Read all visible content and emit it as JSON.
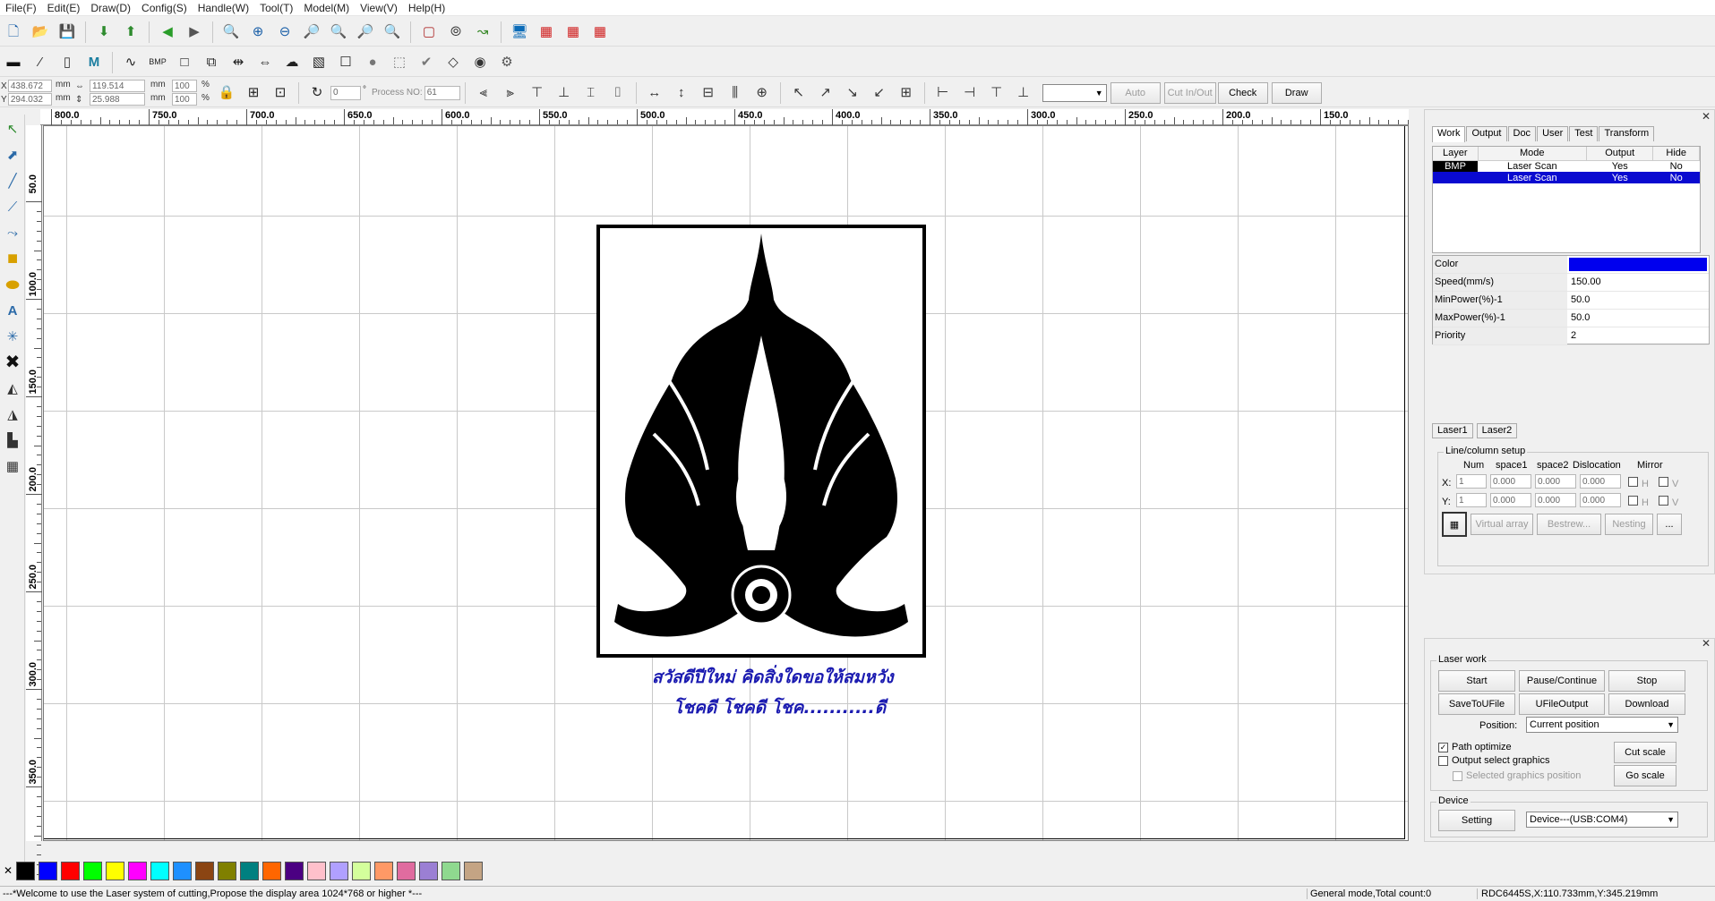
{
  "menu": [
    "File(F)",
    "Edit(E)",
    "Draw(D)",
    "Config(S)",
    "Handle(W)",
    "Tool(T)",
    "Model(M)",
    "View(V)",
    "Help(H)"
  ],
  "coords": {
    "x_label": "X",
    "x_value": "438.672",
    "x_unit": "mm",
    "y_label": "Y",
    "y_value": "294.032",
    "y_unit": "mm",
    "w_value": "119.514",
    "w_unit": "mm",
    "h_value": "25.988",
    "h_unit": "mm",
    "w_pct": "100",
    "h_pct": "100",
    "pct_unit": "%",
    "angle_value": "0",
    "angle_unit": "°",
    "process_label": "Process NO:",
    "process_value": "61"
  },
  "toolbar3": {
    "auto": "Auto",
    "cut_in_out": "Cut In/Out",
    "check": "Check",
    "draw": "Draw"
  },
  "toolbar2": {
    "bmp": "BMP",
    "m": "M"
  },
  "ruler_h": [
    "800.0",
    "750.0",
    "700.0",
    "650.0",
    "600.0",
    "550.0",
    "500.0",
    "450.0",
    "400.0",
    "350.0",
    "300.0",
    "250.0",
    "200.0",
    "150.0"
  ],
  "ruler_v": [
    "50.0",
    "100.0",
    "150.0",
    "200.0",
    "250.0",
    "300.0",
    "350.0"
  ],
  "canvas_text": {
    "line1": "สวัสดีปีใหม่ คิดสิ่งใดขอให้สมหวัง",
    "line2": "โชคดี โชคดี โชค...........ดี"
  },
  "panel": {
    "tabs": [
      "Work",
      "Output",
      "Doc",
      "User",
      "Test",
      "Transform"
    ],
    "active_tab": "Work",
    "layer_headers": [
      "Layer",
      "Mode",
      "Output",
      "Hide"
    ],
    "layers": [
      {
        "layer": "BMP",
        "mode": "Laser Scan",
        "output": "Yes",
        "hide": "No"
      },
      {
        "layer": "",
        "mode": "Laser Scan",
        "output": "Yes",
        "hide": "No"
      }
    ],
    "props": [
      {
        "key": "Color",
        "value": ""
      },
      {
        "key": "Speed(mm/s)",
        "value": "150.00"
      },
      {
        "key": "MinPower(%)-1",
        "value": "50.0"
      },
      {
        "key": "MaxPower(%)-1",
        "value": "50.0"
      },
      {
        "key": "Priority",
        "value": "2"
      }
    ],
    "color_swatch": "#0000ee",
    "laser_tabs": [
      "Laser1",
      "Laser2"
    ],
    "linecol": {
      "title": "Line/column setup",
      "headers": [
        "Num",
        "space1",
        "space2",
        "Dislocation",
        "Mirror"
      ],
      "x_label": "X:",
      "y_label": "Y:",
      "x": {
        "num": "1",
        "space1": "0.000",
        "space2": "0.000",
        "disloc": "0.000"
      },
      "y": {
        "num": "1",
        "space1": "0.000",
        "space2": "0.000",
        "disloc": "0.000"
      },
      "mirror_h": "H",
      "mirror_v": "V",
      "virtual_array": "Virtual array",
      "bestrew": "Bestrew...",
      "nesting": "Nesting",
      "more": "..."
    }
  },
  "laserwork": {
    "title": "Laser work",
    "start": "Start",
    "pause": "Pause/Continue",
    "stop": "Stop",
    "save_ufile": "SaveToUFile",
    "ufile_output": "UFileOutput",
    "download": "Download",
    "position_label": "Position:",
    "position_value": "Current position",
    "path_optimize": "Path optimize",
    "path_optimize_checked": true,
    "output_select": "Output select graphics",
    "selected_pos": "Selected graphics position",
    "cut_scale": "Cut scale",
    "go_scale": "Go scale",
    "device_title": "Device",
    "setting": "Setting",
    "device_value": "Device---(USB:COM4)"
  },
  "palette": [
    "#000000",
    "#0000ff",
    "#ff0000",
    "#00ff00",
    "#ffff00",
    "#ff00ff",
    "#00ffff",
    "#1e90ff",
    "#8b4513",
    "#808000",
    "#008080",
    "#ff6600",
    "#4b0082",
    "#ffc0cb",
    "#b0a0ff",
    "#d4ff9c",
    "#ff9966",
    "#e06c9f",
    "#9b7fd4",
    "#8fd98f",
    "#c4a484"
  ],
  "status": {
    "welcome": "---*Welcome to use the Laser system of cutting,Propose the display area 1024*768 or higher *---",
    "mode": "General mode,Total count:0",
    "position": "RDC6445S,X:110.733mm,Y:345.219mm"
  }
}
